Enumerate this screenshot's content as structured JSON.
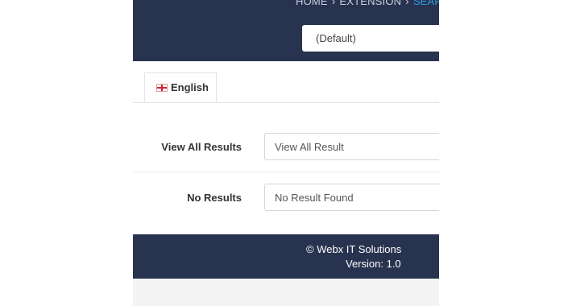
{
  "breadcrumb": {
    "home": "HOME",
    "extension": "EXTENSION",
    "current": "SEARC",
    "separator": "›"
  },
  "store_select": {
    "value": "(Default)"
  },
  "tabs": [
    {
      "label": "English",
      "flag_icon": "uk-flag-icon",
      "active": true
    }
  ],
  "form": {
    "view_all_results": {
      "label": "View All Results",
      "value": "View All Result"
    },
    "no_results": {
      "label": "No Results",
      "value": "No Result Found"
    }
  },
  "footer": {
    "copyright": "© Webx IT Solutions",
    "version": "Version: 1.0"
  },
  "colors": {
    "header_bg": "#28334f",
    "footer_bg": "#28334f",
    "breadcrumb_active": "#2e9be0"
  }
}
